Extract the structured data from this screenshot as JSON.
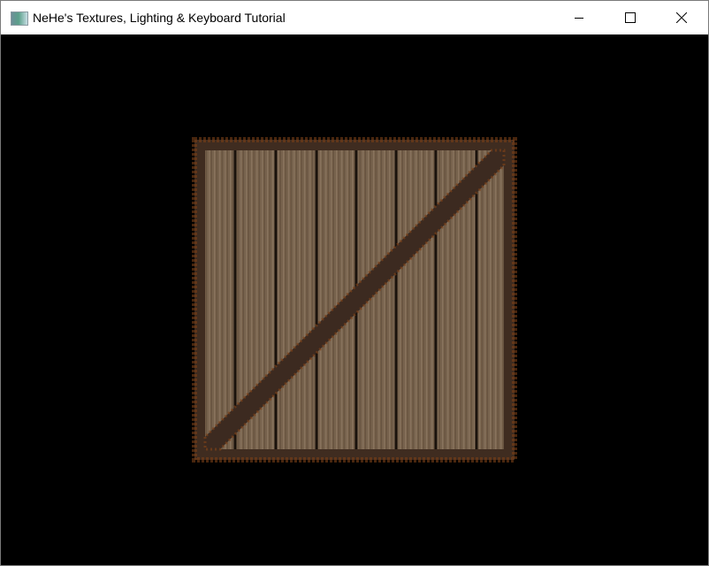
{
  "window": {
    "title": "NeHe's Textures, Lighting & Keyboard Tutorial",
    "icon": "opengl-app-icon",
    "controls": [
      "minimize-icon",
      "maximize-icon",
      "close-icon"
    ]
  },
  "scene": {
    "object": "textured wooden crate",
    "colors": {
      "background": "#000000",
      "wood": "#7a644c",
      "frame": "#4a3322",
      "rust": "#8a4a1c"
    }
  }
}
